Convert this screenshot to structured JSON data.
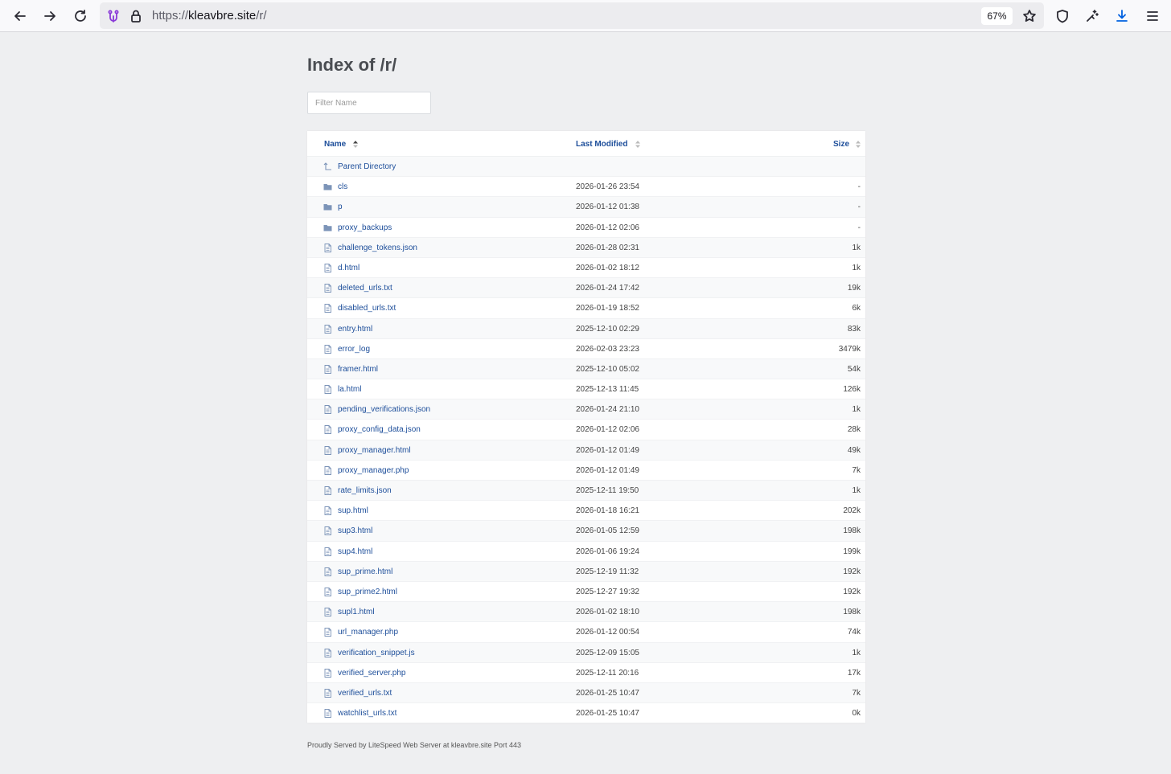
{
  "browser": {
    "url_scheme": "https://",
    "url_host": "kleavbre.site",
    "url_path": "/r/",
    "zoom": "67%"
  },
  "page": {
    "title": "Index of /r/",
    "filter_placeholder": "Filter Name",
    "columns": {
      "name": "Name",
      "modified": "Last Modified",
      "size": "Size"
    },
    "parent_label": "Parent Directory",
    "footer": "Proudly Served by LiteSpeed Web Server at kleavbre.site Port 443"
  },
  "colors": {
    "link": "#1d4e9a",
    "background": "#eeeff1",
    "folder": "#7c94b8"
  },
  "entries": [
    {
      "name": "cls",
      "modified": "2026-01-26 23:54",
      "size": "-",
      "type": "folder"
    },
    {
      "name": "p",
      "modified": "2026-01-12 01:38",
      "size": "-",
      "type": "folder"
    },
    {
      "name": "proxy_backups",
      "modified": "2026-01-12 02:06",
      "size": "-",
      "type": "folder"
    },
    {
      "name": "challenge_tokens.json",
      "modified": "2026-01-28 02:31",
      "size": "1k",
      "type": "file"
    },
    {
      "name": "d.html",
      "modified": "2026-01-02 18:12",
      "size": "1k",
      "type": "file"
    },
    {
      "name": "deleted_urls.txt",
      "modified": "2026-01-24 17:42",
      "size": "19k",
      "type": "file"
    },
    {
      "name": "disabled_urls.txt",
      "modified": "2026-01-19 18:52",
      "size": "6k",
      "type": "file"
    },
    {
      "name": "entry.html",
      "modified": "2025-12-10 02:29",
      "size": "83k",
      "type": "file"
    },
    {
      "name": "error_log",
      "modified": "2026-02-03 23:23",
      "size": "3479k",
      "type": "file"
    },
    {
      "name": "framer.html",
      "modified": "2025-12-10 05:02",
      "size": "54k",
      "type": "file"
    },
    {
      "name": "la.html",
      "modified": "2025-12-13 11:45",
      "size": "126k",
      "type": "file"
    },
    {
      "name": "pending_verifications.json",
      "modified": "2026-01-24 21:10",
      "size": "1k",
      "type": "file"
    },
    {
      "name": "proxy_config_data.json",
      "modified": "2026-01-12 02:06",
      "size": "28k",
      "type": "file"
    },
    {
      "name": "proxy_manager.html",
      "modified": "2026-01-12 01:49",
      "size": "49k",
      "type": "file"
    },
    {
      "name": "proxy_manager.php",
      "modified": "2026-01-12 01:49",
      "size": "7k",
      "type": "file"
    },
    {
      "name": "rate_limits.json",
      "modified": "2025-12-11 19:50",
      "size": "1k",
      "type": "file"
    },
    {
      "name": "sup.html",
      "modified": "2026-01-18 16:21",
      "size": "202k",
      "type": "file"
    },
    {
      "name": "sup3.html",
      "modified": "2026-01-05 12:59",
      "size": "198k",
      "type": "file"
    },
    {
      "name": "sup4.html",
      "modified": "2026-01-06 19:24",
      "size": "199k",
      "type": "file"
    },
    {
      "name": "sup_prime.html",
      "modified": "2025-12-19 11:32",
      "size": "192k",
      "type": "file"
    },
    {
      "name": "sup_prime2.html",
      "modified": "2025-12-27 19:32",
      "size": "192k",
      "type": "file"
    },
    {
      "name": "supl1.html",
      "modified": "2026-01-02 18:10",
      "size": "198k",
      "type": "file"
    },
    {
      "name": "url_manager.php",
      "modified": "2026-01-12 00:54",
      "size": "74k",
      "type": "file"
    },
    {
      "name": "verification_snippet.js",
      "modified": "2025-12-09 15:05",
      "size": "1k",
      "type": "file"
    },
    {
      "name": "verified_server.php",
      "modified": "2025-12-11 20:16",
      "size": "17k",
      "type": "file"
    },
    {
      "name": "verified_urls.txt",
      "modified": "2026-01-25 10:47",
      "size": "7k",
      "type": "file"
    },
    {
      "name": "watchlist_urls.txt",
      "modified": "2026-01-25 10:47",
      "size": "0k",
      "type": "file"
    }
  ]
}
